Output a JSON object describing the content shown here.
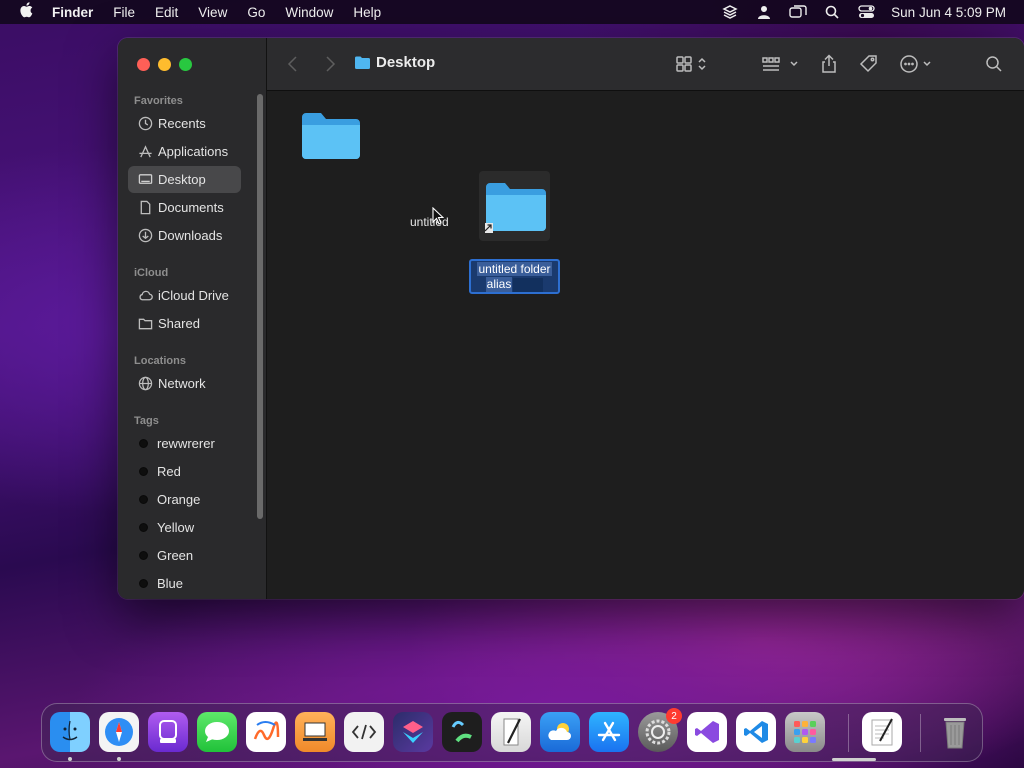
{
  "menubar": {
    "app_name": "Finder",
    "menus": [
      "File",
      "Edit",
      "View",
      "Go",
      "Window",
      "Help"
    ],
    "clock": "Sun Jun 4  5:09 PM"
  },
  "window": {
    "title": "Desktop",
    "sidebar": {
      "favorites_header": "Favorites",
      "favorites": [
        {
          "label": "Recents",
          "icon": "clock-icon"
        },
        {
          "label": "Applications",
          "icon": "applications-icon"
        },
        {
          "label": "Desktop",
          "icon": "desktop-icon",
          "active": true
        },
        {
          "label": "Documents",
          "icon": "document-icon"
        },
        {
          "label": "Downloads",
          "icon": "download-icon"
        }
      ],
      "icloud_header": "iCloud",
      "icloud": [
        {
          "label": "iCloud Drive",
          "icon": "cloud-icon"
        },
        {
          "label": "Shared",
          "icon": "shared-folder-icon"
        }
      ],
      "locations_header": "Locations",
      "locations": [
        {
          "label": "Network",
          "icon": "globe-icon"
        }
      ],
      "tags_header": "Tags",
      "tags": [
        "rewwrerer",
        "Red",
        "Orange",
        "Yellow",
        "Green",
        "Blue"
      ]
    },
    "files": [
      {
        "label": "untitled",
        "icon": "folder-icon"
      },
      {
        "label_line1": "untitled folder",
        "label_line2": "alias",
        "icon": "folder-alias-icon",
        "renaming": true
      }
    ]
  },
  "dock": {
    "apps": [
      {
        "name": "finder-icon"
      },
      {
        "name": "safari-icon"
      },
      {
        "name": "podcasts-icon"
      },
      {
        "name": "messages-icon"
      },
      {
        "name": "freeform-icon"
      },
      {
        "name": "slides-icon"
      },
      {
        "name": "script-editor-icon"
      },
      {
        "name": "shortcuts-icon"
      },
      {
        "name": "stocks-icon"
      },
      {
        "name": "script-icon"
      },
      {
        "name": "weather-icon"
      },
      {
        "name": "app-store-icon"
      },
      {
        "name": "system-settings-icon",
        "badge": "2"
      },
      {
        "name": "visual-studio-icon"
      },
      {
        "name": "vscode-icon"
      },
      {
        "name": "launchpad-icon"
      },
      {
        "name": "textedit-icon"
      },
      {
        "name": "trash-icon"
      }
    ]
  },
  "colors": {
    "accent": "#2d6fd1",
    "folder": "#4fb6f0"
  }
}
